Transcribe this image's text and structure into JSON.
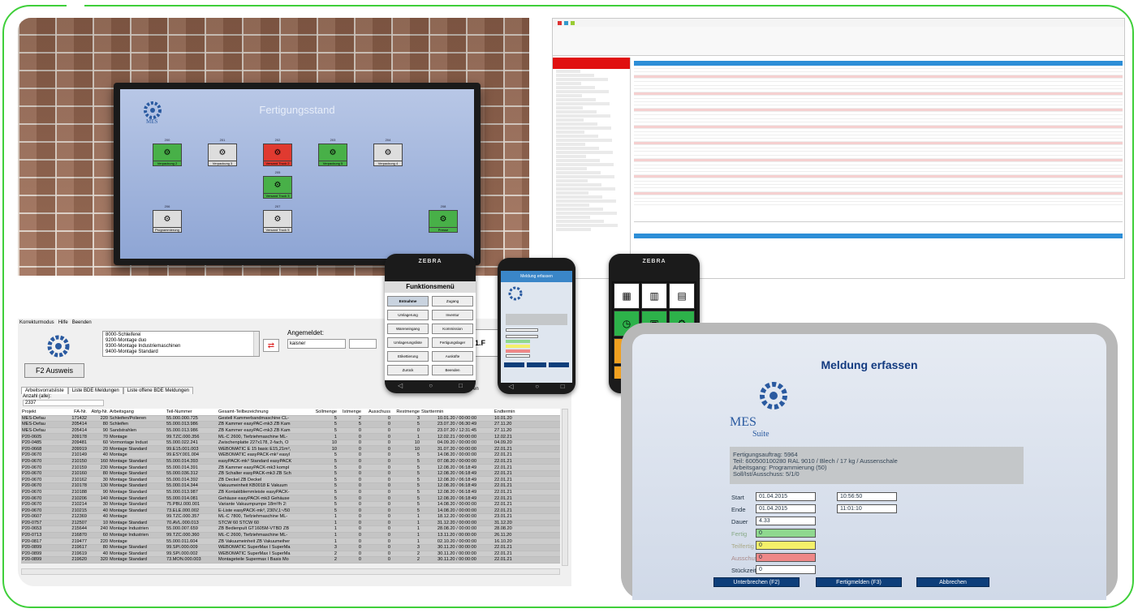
{
  "display": {
    "title": "Fertigungsstand",
    "tiles": [
      {
        "id": "200",
        "label": "Verpackung 2",
        "state": "g"
      },
      {
        "id": "201",
        "label": "Verpackung 3",
        "state": "n"
      },
      {
        "id": "202",
        "label": "Versand Truck 2",
        "state": "r"
      },
      {
        "id": "203",
        "label": "Verpackung 5",
        "state": "g"
      },
      {
        "id": "204",
        "label": "Verpackung 4",
        "state": "n"
      },
      {
        "id": "205",
        "label": "Versand Truck 3",
        "state": "g"
      },
      {
        "id": "206",
        "label": "Programmierung",
        "state": "n"
      },
      {
        "id": "207",
        "label": "Versand Truck 5",
        "state": "n"
      },
      {
        "id": "208",
        "label": "Presse",
        "state": "g"
      }
    ]
  },
  "list": {
    "menu": [
      "Korrekturmodus",
      "Hilfe",
      "Beenden"
    ],
    "workplaces": [
      "8000-Schleiferei",
      "9200-Montage duo",
      "9300-Montage Industriemaschinen",
      "9400-Montage Standard"
    ],
    "angemeldet_label": "Angemeldet:",
    "angemeldet_value": "kaisner",
    "box_text": "1.F",
    "ausweis_button": "F2 Ausweis",
    "tabs": [
      "Arbeitsvorratsliste",
      "Liste BDE Meldungen",
      "Liste offene BDE Meldungen"
    ],
    "anzahl_label": "Anzahl (alle):",
    "anzahl_value": "2337",
    "filter_label": "Filter aktivieren",
    "columns": [
      "Projekt",
      "FA-Nr.",
      "Abfg-Nr.",
      "Arbeitsgang",
      "Teil-Nummer",
      "Gesamt-Teilbezeichnung",
      "Sollmenge",
      "Istmenge",
      "Ausschuss",
      "Restmenge",
      "Starttermin",
      "Endtermin"
    ],
    "rows": [
      [
        "MES-Defau",
        "171432",
        "220",
        "Schleifen/Polieren",
        "55.000.000.725",
        "Gestell Kammerbandmaschine CL-",
        "5",
        "2",
        "0",
        "3",
        "10.01.20 / 00:00:00",
        "10.01.20"
      ],
      [
        "MES-Defau",
        "205414",
        "80",
        "Schleifen",
        "55.000.013.986",
        "ZB Kammer easyPAC-mk3 ZB Kam",
        "5",
        "5",
        "0",
        "5",
        "23.07.20 / 06:30:49",
        "27.11.20"
      ],
      [
        "MES-Defau",
        "205414",
        "90",
        "Sandstrahlen",
        "55.000.013.986",
        "ZB Kammer easyPAC-mk3 ZB Kam",
        "5",
        "0",
        "0",
        "0",
        "23.07.20 / 12:31:45",
        "27.11.20"
      ],
      [
        "P20-0605",
        "209178",
        "70",
        "Montage",
        "99.TZC.000.356",
        "ML-C 2600, Tiefziehmaschine ML-",
        "1",
        "0",
        "0",
        "1",
        "12.02.21 / 00:00:00",
        "12.02.21"
      ],
      [
        "P20-0485",
        "209481",
        "60",
        "Vormontage Indust",
        "55.000.022.241",
        "Zwischenplatte 227x178, 2-fach, O",
        "10",
        "0",
        "0",
        "10",
        "04.09.20 / 00:00:00",
        "04.09.20"
      ],
      [
        "P20-0668",
        "209919",
        "20",
        "Montage Standard",
        "99.E15.001.003",
        "WEBOMATIC E 15 basic E15,21m³,",
        "10",
        "0",
        "0",
        "10",
        "31.07.20 / 00:00:00",
        "22.01.21"
      ],
      [
        "P20-0670",
        "210149",
        "40",
        "Montage",
        "99.ESY.001.004",
        "WEBOMATIC easyPACK-mk³ easyl",
        "5",
        "0",
        "0",
        "5",
        "14.08.20 / 00:00:00",
        "22.01.21"
      ],
      [
        "P20-0670",
        "210150",
        "160",
        "Montage Standard",
        "55.000.014.393",
        "easyPACK-mk³ Standard easyPACK",
        "5",
        "0",
        "0",
        "5",
        "07.08.20 / 00:00:00",
        "22.01.21"
      ],
      [
        "P20-0670",
        "210159",
        "230",
        "Montage Standard",
        "55.000.014.391",
        "ZB Kammer easyPACK-mk3 kompl",
        "5",
        "0",
        "0",
        "5",
        "12.08.20 / 06:18:49",
        "22.01.21"
      ],
      [
        "P20-0670",
        "210160",
        "80",
        "Montage Standard",
        "55.000.036.312",
        "ZB Schalter easyPACK-mk3 ZB Sch",
        "5",
        "0",
        "0",
        "5",
        "12.08.20 / 06:18:49",
        "22.01.21"
      ],
      [
        "P20-0670",
        "210162",
        "30",
        "Montage Standard",
        "55.000.014.392",
        "ZB Deckel ZB Deckel",
        "5",
        "0",
        "0",
        "5",
        "12.08.20 / 06:18:49",
        "22.01.21"
      ],
      [
        "P20-0670",
        "210178",
        "130",
        "Montage Standard",
        "55.000.014.344",
        "Vakuumeinheit KB0018 E Vakuum",
        "5",
        "0",
        "0",
        "5",
        "12.08.20 / 06:18:49",
        "22.01.21"
      ],
      [
        "P20-0670",
        "210188",
        "90",
        "Montage Standard",
        "55.000.013.987",
        "ZB Kontaktblemmleiste easyPACK-",
        "5",
        "0",
        "0",
        "5",
        "12.08.20 / 06:18:49",
        "22.01.21"
      ],
      [
        "P20-0670",
        "210206",
        "140",
        "Montage Standard",
        "55.000.014.081",
        "Gehäuse easyPACK-mk3 Gehäuse",
        "5",
        "0",
        "0",
        "5",
        "12.08.20 / 06:18:49",
        "22.01.21"
      ],
      [
        "P20-0670",
        "210214",
        "30",
        "Montage Standard",
        "75.PBU.000.001",
        "Variante Vakuumpumpe 18m³/h 2:",
        "5",
        "0",
        "0",
        "5",
        "14.08.20 / 00:00:00",
        "22.01.21"
      ],
      [
        "P20-0670",
        "210215",
        "40",
        "Montage Standard",
        "73.ELE.000.002",
        "E-Liste easyPACK-mk³, 230V,1~/50",
        "5",
        "0",
        "0",
        "5",
        "14.08.20 / 00:00:00",
        "22.01.21"
      ],
      [
        "P20-0607",
        "212369",
        "40",
        "Montage",
        "99.TZC.000.357",
        "ML-C 7800, Tiefziehmaschine ML-",
        "1",
        "0",
        "0",
        "1",
        "18.12.20 / 00:00:00",
        "23.01.21"
      ],
      [
        "P20-0757",
        "212507",
        "10",
        "Montage Standard",
        "70.AVL.000.013",
        "STCW 60 STCW 60",
        "1",
        "0",
        "0",
        "1",
        "31.12.20 / 00:00:00",
        "31.12.20"
      ],
      [
        "P20-0653",
        "215644",
        "240",
        "Montage Industrien",
        "55.000.007.659",
        "ZB Bedienpult GT1605M-VTBD ZB",
        "1",
        "0",
        "0",
        "1",
        "28.08.20 / 00:00:00",
        "28.08.20"
      ],
      [
        "P20-0713",
        "216870",
        "60",
        "Montage Industrien",
        "99.TZC.000.360",
        "ML-C 2600, Tiefziehmaschine ML-",
        "1",
        "0",
        "0",
        "1",
        "13.11.20 / 00:00:00",
        "26.11.20"
      ],
      [
        "P20-0817",
        "219477",
        "220",
        "Montage",
        "55.000.011.604",
        "ZB Vakuumeinheit ZB Vakuumeiher",
        "1",
        "0",
        "0",
        "1",
        "02.10.20 / 00:00:00",
        "16.10.20"
      ],
      [
        "P20-0899",
        "219617",
        "80",
        "Montage Standard",
        "99.SPI.000.009",
        "WEBOMATIC SuperMax I SuperMa",
        "3",
        "0",
        "0",
        "3",
        "30.11.20 / 00:00:00",
        "22.01.21"
      ],
      [
        "P20-0899",
        "219619",
        "40",
        "Montage Standard",
        "99.SPI.000.002",
        "WEBOMATIC SuperMax I SuperMa",
        "2",
        "0",
        "0",
        "2",
        "30.11.20 / 00:00:00",
        "22.01.21"
      ],
      [
        "P20-0899",
        "219620",
        "320",
        "Montage Standard",
        "73.MON.000.003",
        "Montageteile Supermax I Basis Mo",
        "2",
        "0",
        "0",
        "2",
        "30.11.20 / 00:00:00",
        "22.01.21"
      ]
    ]
  },
  "phone1": {
    "brand": "ZEBRA",
    "title": "Funktionsmenü",
    "buttons": [
      "Entnahme",
      "Zugang",
      "Umlagerung",
      "Inventur",
      "Wareneingang",
      "Kommission",
      "Umlagerungsliste",
      "Fertigungslager",
      "Etikettierung",
      "Ausküfte",
      "Zurück",
      "Beenden"
    ]
  },
  "phone2": {
    "title": "Meldung erfassen"
  },
  "phone3": {
    "brand": "ZEBRA"
  },
  "tablet": {
    "title": "Meldung erfassen",
    "brand": "MES",
    "brand_sub": "Suite",
    "info_line1": "Fertigungsauftrag: 5964",
    "info_line2": "Teil: 600500100280 RAL 9010 / Blech / 17 kg / Aussenschale",
    "info_line3": "Arbeitsgang: Programmierung (50)",
    "info_line4": "Soll/Ist/Ausschuss: 5/1/0",
    "start_label": "Start",
    "start_date": "01.04.2015",
    "start_time": "10:56:50",
    "end_label": "Ende",
    "end_date": "01.04.2015",
    "end_time": "11:01:10",
    "dauer_label": "Dauer",
    "dauer_value": "4.33",
    "fertig_label": "Fertig",
    "fertig_value": "0",
    "teilfertig_label": "Teilfertig",
    "teilfertig_value": "0",
    "ausschuss_label": "Ausschuss",
    "ausschuss_value": "0",
    "stueckzeit_label": "Stückzeit",
    "stueckzeit_value": "0",
    "btn_interrupt": "Unterbrechen (F2)",
    "btn_finish": "Fertigmelden (F3)",
    "btn_cancel": "Abbrechen"
  },
  "colors": {
    "accent_green": "#3fcf3a",
    "header_blue": "#2d8ed7",
    "tablet_button": "#0d3e7a"
  }
}
